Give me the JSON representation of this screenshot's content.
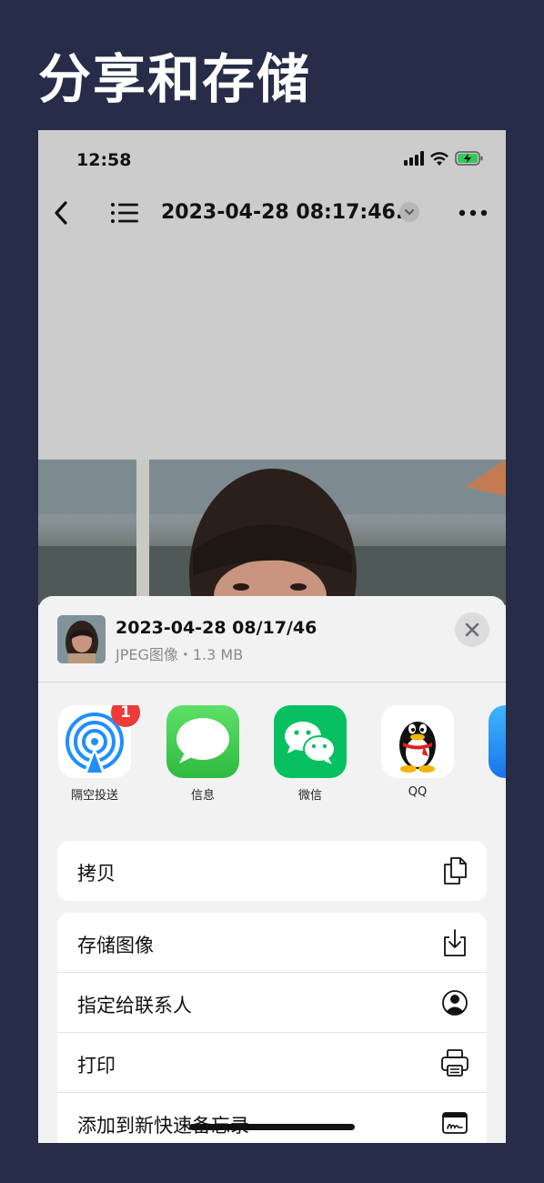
{
  "headline": "分享和存储",
  "status": {
    "time": "12:58"
  },
  "nav": {
    "title": "2023-04-28 08:17:46..."
  },
  "file": {
    "name": "2023-04-28 08/17/46",
    "meta": "JPEG图像・1.3 MB"
  },
  "apps": [
    {
      "label": "隔空投送",
      "badge": "1",
      "icon": "airdrop-icon"
    },
    {
      "label": "信息",
      "icon": "messages-icon"
    },
    {
      "label": "微信",
      "icon": "wechat-icon"
    },
    {
      "label": "QQ",
      "icon": "qq-icon"
    }
  ],
  "actions": {
    "copy": "拷贝",
    "save_image": "存储图像",
    "assign_contact": "指定给联系人",
    "print": "打印",
    "add_quick_note": "添加到新快速备忘录"
  },
  "colors": {
    "background": "#272c48",
    "sheet": "#f2f2f3",
    "messages": "#34c759",
    "wechat": "#07c160",
    "airdrop": "#1f8fff",
    "badge": "#ef3b37"
  }
}
